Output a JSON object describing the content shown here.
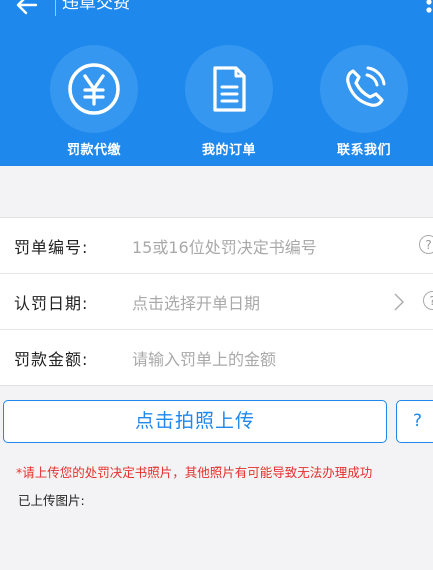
{
  "colors": {
    "brand": "#1e88ec",
    "circle": "#3597f0",
    "warning": "#e5302a"
  },
  "header": {
    "title": "违章交费",
    "back_icon": "arrow-left-icon",
    "menu_icon": "more-vertical-icon"
  },
  "nav": [
    {
      "label": "罚款代缴",
      "icon": "yen-coin-icon"
    },
    {
      "label": "我的订单",
      "icon": "document-icon"
    },
    {
      "label": "联系我们",
      "icon": "phone-icon"
    }
  ],
  "form": {
    "ticket_number": {
      "label": "罚单编号:",
      "placeholder": "15或16位处罚决定书编号",
      "help": "?"
    },
    "date": {
      "label": "认罚日期:",
      "placeholder": "点击选择开单日期",
      "help": "?"
    },
    "amount": {
      "label": "罚款金额:",
      "placeholder": "请输入罚单上的金额"
    }
  },
  "upload": {
    "button_label": "点击拍照上传",
    "help_label": "?"
  },
  "notice": "*请上传您的处罚决定书照片，其他照片有可能导致无法办理成功",
  "uploaded_label": "已上传图片:"
}
